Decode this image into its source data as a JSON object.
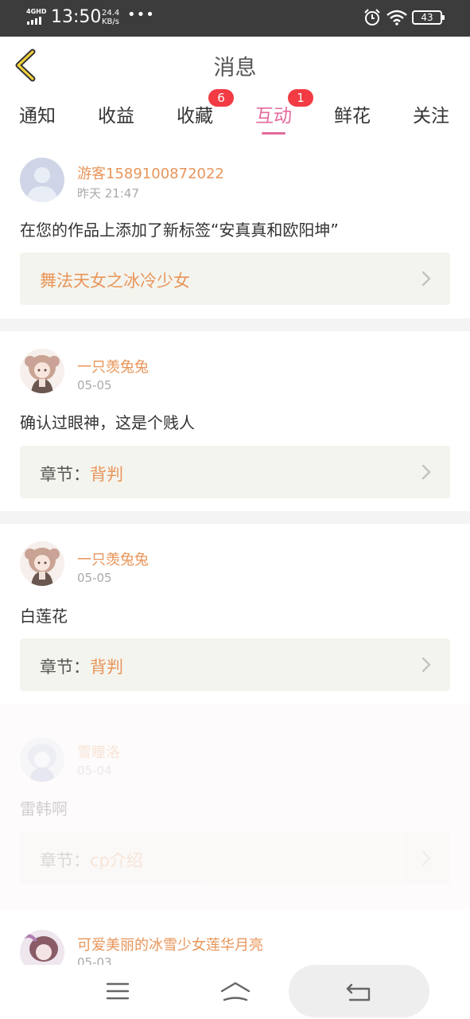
{
  "status_bar": {
    "network": "4GHD",
    "time": "13:50",
    "speed_value": "24.4",
    "speed_unit": "KB/s",
    "more": "•••",
    "battery": "43",
    "icons": [
      "signal-icon",
      "alarm-icon",
      "wifi-icon",
      "battery-icon"
    ]
  },
  "header": {
    "title": "消息",
    "back_icon": "chevron-left-icon"
  },
  "tabs": [
    {
      "label": "通知",
      "active": false
    },
    {
      "label": "收益",
      "active": false
    },
    {
      "label": "收藏",
      "active": false,
      "badge": "6"
    },
    {
      "label": "互动",
      "active": true,
      "badge": "1"
    },
    {
      "label": "鲜花",
      "active": false
    },
    {
      "label": "关注",
      "active": false
    }
  ],
  "messages": [
    {
      "user": "游客1589100872022",
      "date": "昨天 21:47",
      "text": "在您的作品上添加了新标签“安真真和欧阳坤”",
      "ref_label": "",
      "ref_value": "舞法天女之冰冷少女",
      "avatar": "default-avatar"
    },
    {
      "user": "一只羡兔兔",
      "date": "05-05",
      "text": "确认过眼神，这是个贱人",
      "ref_label": "章节：",
      "ref_value": "背判",
      "avatar": "anime-girl-avatar"
    },
    {
      "user": "一只羡兔兔",
      "date": "05-05",
      "text": "白莲花",
      "ref_label": "章节：",
      "ref_value": "背判",
      "avatar": "anime-girl-avatar"
    },
    {
      "user": "雪瞳洛",
      "date": "05-04",
      "text": "雷韩啊",
      "ref_label": "章节：",
      "ref_value": "cp介绍",
      "avatar": "snow-girl-avatar",
      "faded": true
    },
    {
      "user": "可爱美丽的冰雪少女莲华月亮",
      "date": "05-03",
      "avatar": "ice-girl-avatar"
    }
  ],
  "nav_bar": {
    "icons": [
      "menu-icon",
      "home-icon",
      "back-icon"
    ]
  },
  "colors": {
    "accent": "#e46a9c",
    "username": "#e8955a",
    "badge": "#f23b43",
    "ref_bg": "#f4f4ee",
    "status_bar": "#3c3c3c"
  }
}
